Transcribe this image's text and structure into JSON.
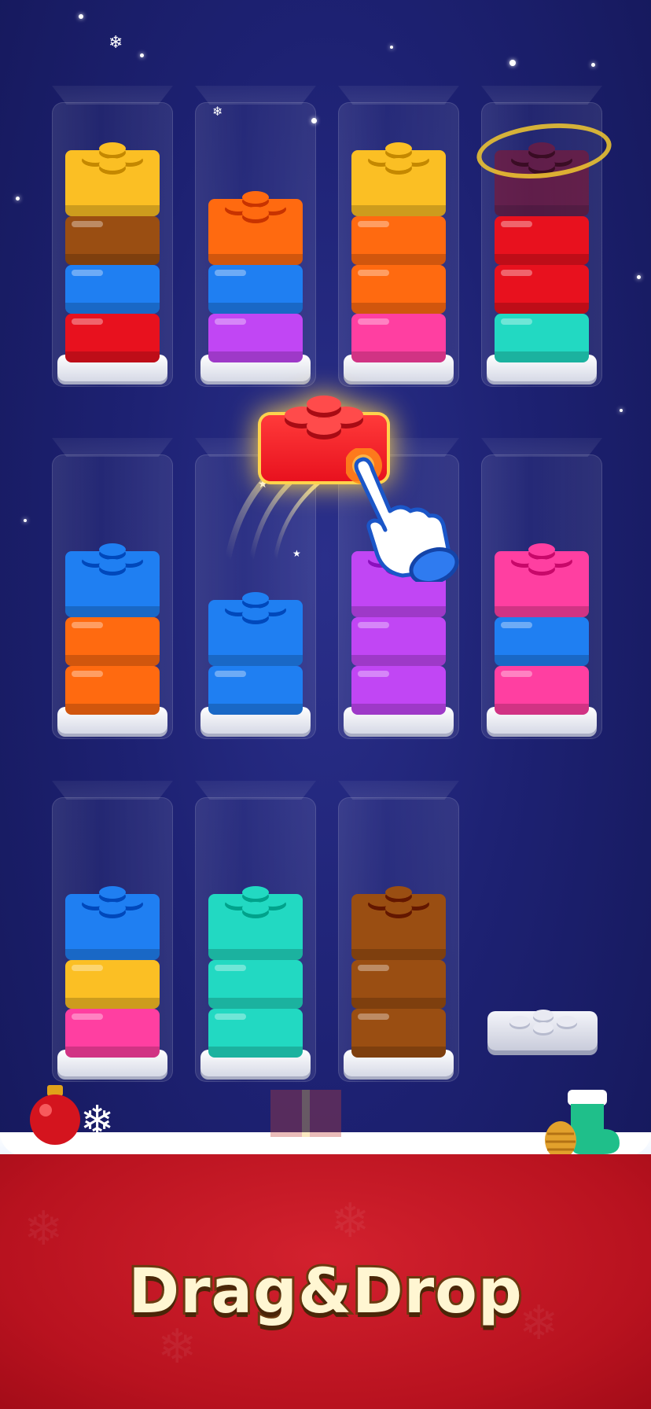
{
  "title": "Drag&Drop",
  "colors": {
    "yellow": "#fbbf24",
    "brown": "#9a4e12",
    "blue": "#1f7ff2",
    "red": "#e8111e",
    "orange": "#ff6a10",
    "purple": "#c146f4",
    "pink": "#ff3fa1",
    "teal": "#22d9c2",
    "darkred": "#7a1a3a"
  },
  "tubes": [
    {
      "name": "tube-row1-col1",
      "bricks_bottom_to_top": [
        "red",
        "blue",
        "brown",
        "yellow"
      ]
    },
    {
      "name": "tube-row1-col2",
      "bricks_bottom_to_top": [
        "purple",
        "blue",
        "orange"
      ]
    },
    {
      "name": "tube-row1-col3",
      "bricks_bottom_to_top": [
        "pink",
        "orange",
        "orange",
        "yellow"
      ]
    },
    {
      "name": "tube-row1-col4",
      "bricks_bottom_to_top": [
        "teal",
        "red",
        "red",
        "darkred"
      ]
    },
    {
      "name": "tube-row2-col1",
      "bricks_bottom_to_top": [
        "orange",
        "orange",
        "blue"
      ]
    },
    {
      "name": "tube-row2-col2",
      "bricks_bottom_to_top": [
        "blue",
        "blue"
      ]
    },
    {
      "name": "tube-row2-col3",
      "bricks_bottom_to_top": [
        "purple",
        "purple",
        "purple"
      ]
    },
    {
      "name": "tube-row2-col4",
      "bricks_bottom_to_top": [
        "pink",
        "blue",
        "pink"
      ]
    },
    {
      "name": "tube-row3-col1",
      "bricks_bottom_to_top": [
        "pink",
        "yellow",
        "blue"
      ]
    },
    {
      "name": "tube-row3-col2",
      "bricks_bottom_to_top": [
        "teal",
        "teal",
        "teal"
      ]
    },
    {
      "name": "tube-row3-col3",
      "bricks_bottom_to_top": [
        "brown",
        "brown",
        "brown"
      ]
    }
  ],
  "floating_brick": "red",
  "icons": [
    "pointing-hand-icon",
    "snowflake-icon",
    "christmas-ornament-icon",
    "stocking-icon",
    "pinecone-icon",
    "gift-icon"
  ]
}
